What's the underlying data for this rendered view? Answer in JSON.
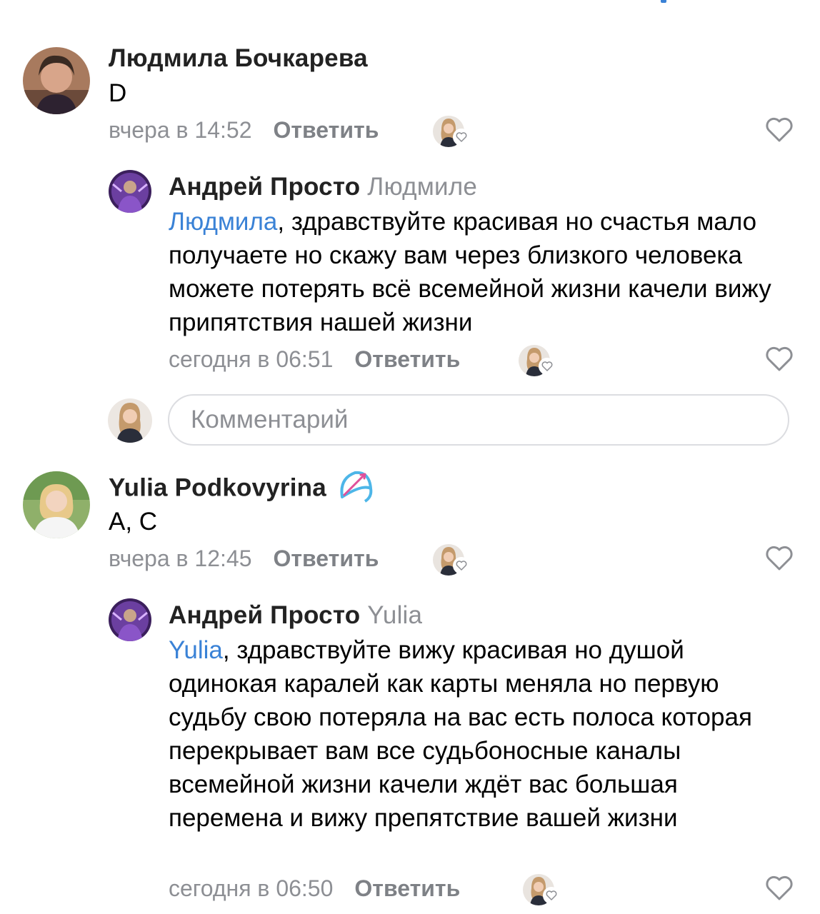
{
  "comments": [
    {
      "author": "Людмила Бочкарева",
      "text": "D",
      "time": "вчера в 14:52",
      "reply_label": "Ответить",
      "reply": {
        "author": "Андрей Просто",
        "reply_to": "Людмиле",
        "mention": "Людмила",
        "text": ", здравствуйте красивая но счастья мало получаете но скажу вам через близкого человека можете потерять всё всемейной жизни качели вижу припятствия нашей жизни",
        "time": "сегодня в 06:51",
        "reply_label": "Ответить"
      }
    },
    {
      "author": "Yulia Podkovyrina",
      "text": "A, C",
      "time": "вчера в 12:45",
      "reply_label": "Ответить",
      "reply": {
        "author": "Андрей Просто",
        "reply_to": "Yulia",
        "mention": "Yulia",
        "text": ", здравствуйте вижу красивая но душой одинокая каралей как карты меняла но первую судьбу свою потеряла на вас есть полоса которая перекрывает вам все судьбоносные каналы всемейной жизни качели ждёт вас большая перемена и вижу препятствие вашей жизни",
        "time": "сегодня в 06:50",
        "reply_label": "Ответить"
      }
    }
  ],
  "comment_input": {
    "placeholder": "Комментарий"
  },
  "icons": {
    "like": "heart-outline-icon",
    "badge": "bow-and-arrow-icon"
  },
  "colors": {
    "mention": "#3a82d6",
    "meta": "#8d8f94",
    "badge": "#4db6e8",
    "arrow": "#e0509a"
  }
}
